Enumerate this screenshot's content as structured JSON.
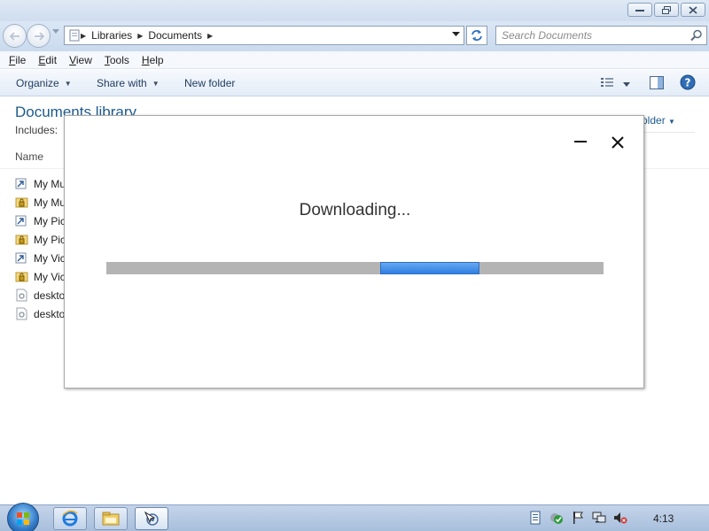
{
  "window": {
    "controls": [
      {
        "name": "minimize-button",
        "icon": "minimize-icon"
      },
      {
        "name": "maximize-button",
        "icon": "restore-icon"
      },
      {
        "name": "close-button",
        "icon": "close-icon"
      }
    ]
  },
  "navigation": {
    "breadcrumbs": [
      "Libraries",
      "Documents"
    ],
    "search_placeholder": "Search Documents"
  },
  "menu": {
    "items": [
      "File",
      "Edit",
      "View",
      "Tools",
      "Help"
    ]
  },
  "toolbar": {
    "organize_label": "Organize",
    "share_label": "Share with",
    "new_folder_label": "New folder"
  },
  "library": {
    "title": "Documents library",
    "includes_label": "Includes:",
    "arrange_label": "older",
    "column_name": "Name",
    "files": [
      {
        "label": "My Mu",
        "icon": "shortcut-icon"
      },
      {
        "label": "My Mu",
        "icon": "locked-folder-icon"
      },
      {
        "label": "My Pic",
        "icon": "shortcut-icon"
      },
      {
        "label": "My Pic",
        "icon": "locked-folder-icon"
      },
      {
        "label": "My Vic",
        "icon": "shortcut-icon"
      },
      {
        "label": "My Vic",
        "icon": "locked-folder-icon"
      },
      {
        "label": "deskto",
        "icon": "settings-file-icon"
      },
      {
        "label": "deskto",
        "icon": "settings-file-icon"
      }
    ]
  },
  "dialog": {
    "title": "Downloading...",
    "progress_chunk_start": 0.55,
    "progress_chunk_end": 0.75,
    "accent": "#2f7ee2"
  },
  "taskbar": {
    "apps": [
      "internet-explorer-icon",
      "explorer-icon",
      "installer-icon"
    ],
    "clock": "4:13"
  }
}
